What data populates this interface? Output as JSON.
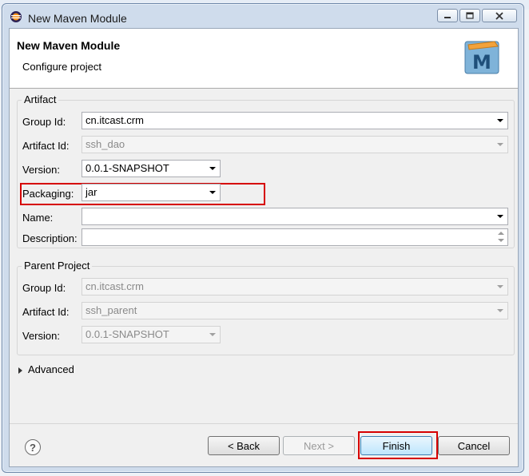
{
  "window": {
    "title": "New Maven Module"
  },
  "header": {
    "title": "New Maven Module",
    "subtitle": "Configure project",
    "logo_letter": "M"
  },
  "artifact": {
    "section_label": "Artifact",
    "group_id": {
      "label": "Group Id:",
      "value": "cn.itcast.crm"
    },
    "artifact_id": {
      "label": "Artifact Id:",
      "value": "ssh_dao"
    },
    "version": {
      "label": "Version:",
      "value": "0.0.1-SNAPSHOT"
    },
    "packaging": {
      "label": "Packaging:",
      "value": "jar"
    },
    "name": {
      "label": "Name:",
      "value": ""
    },
    "description": {
      "label": "Description:",
      "value": ""
    }
  },
  "parent": {
    "section_label": "Parent Project",
    "group_id": {
      "label": "Group Id:",
      "value": "cn.itcast.crm"
    },
    "artifact_id": {
      "label": "Artifact Id:",
      "value": "ssh_parent"
    },
    "version": {
      "label": "Version:",
      "value": "0.0.1-SNAPSHOT"
    }
  },
  "advanced": {
    "label": "Advanced"
  },
  "buttons": {
    "help": "?",
    "back": "< Back",
    "next": "Next >",
    "finish": "Finish",
    "cancel": "Cancel"
  },
  "colors": {
    "highlight": "#d60000",
    "accent": "#3c7fb1"
  }
}
